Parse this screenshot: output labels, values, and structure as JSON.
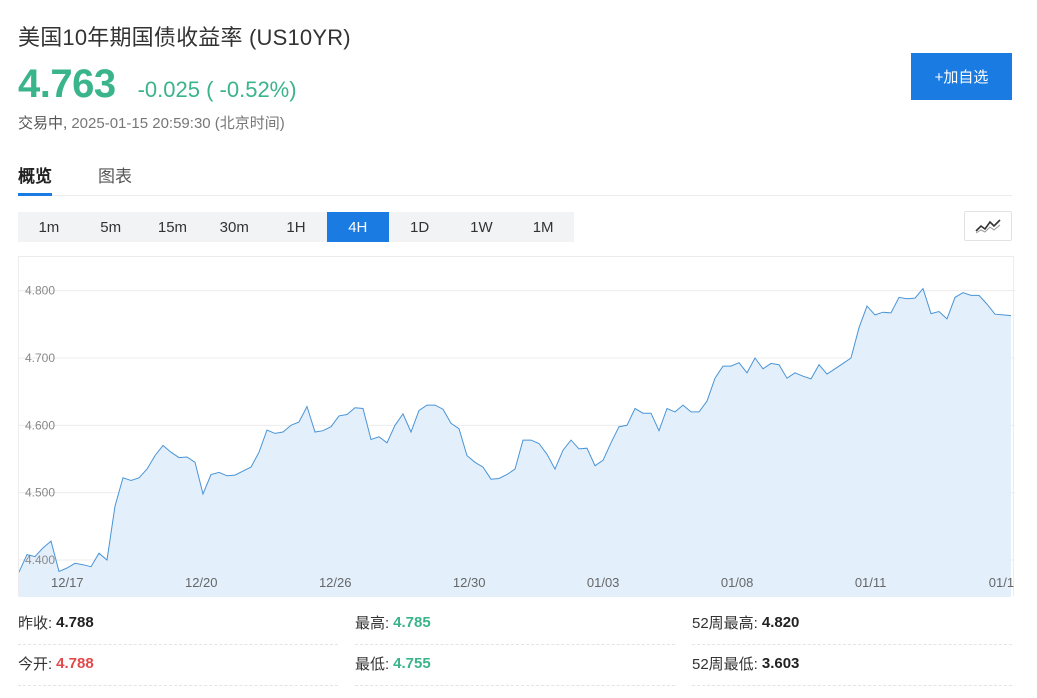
{
  "header": {
    "title": "美国10年期国债收益率 (US10YR)",
    "price": "4.763",
    "change": "-0.025 ( -0.52%)",
    "status_label": "交易中,",
    "timestamp": "2025-01-15 20:59:30 (北京时间)",
    "add_button": "+加自选"
  },
  "colors": {
    "accent": "#1a7be3",
    "down": "#3ab48a",
    "up": "#e24a4a",
    "line": "#4a94d6",
    "fill": "#e3f0fc"
  },
  "tabs": [
    {
      "label": "概览",
      "active": true
    },
    {
      "label": "图表",
      "active": false
    }
  ],
  "periods": [
    {
      "label": "1m",
      "active": false
    },
    {
      "label": "5m",
      "active": false
    },
    {
      "label": "15m",
      "active": false
    },
    {
      "label": "30m",
      "active": false
    },
    {
      "label": "1H",
      "active": false
    },
    {
      "label": "4H",
      "active": true
    },
    {
      "label": "1D",
      "active": false
    },
    {
      "label": "1W",
      "active": false
    },
    {
      "label": "1M",
      "active": false
    }
  ],
  "chart_type_icon": "line-chart-icon",
  "chart_data": {
    "type": "area",
    "y_ticks": [
      "4.800",
      "4.700",
      "4.600",
      "4.500",
      "4.400"
    ],
    "x_ticks": [
      "12/17",
      "12/20",
      "12/26",
      "12/30",
      "01/03",
      "01/08",
      "01/11",
      "01/1"
    ],
    "ylim": [
      4.345,
      4.85
    ],
    "grid": true,
    "values": [
      4.382,
      4.408,
      4.405,
      4.418,
      4.428,
      4.383,
      4.388,
      4.395,
      4.393,
      4.39,
      4.41,
      4.4,
      4.48,
      4.522,
      4.518,
      4.522,
      4.535,
      4.555,
      4.57,
      4.56,
      4.552,
      4.553,
      4.545,
      4.498,
      4.527,
      4.53,
      4.525,
      4.526,
      4.532,
      4.538,
      4.56,
      4.593,
      4.588,
      4.59,
      4.6,
      4.605,
      4.628,
      4.59,
      4.592,
      4.598,
      4.614,
      4.616,
      4.626,
      4.625,
      4.579,
      4.583,
      4.574,
      4.6,
      4.617,
      4.59,
      4.622,
      4.63,
      4.63,
      4.624,
      4.603,
      4.595,
      4.555,
      4.545,
      4.538,
      4.52,
      4.521,
      4.527,
      4.535,
      4.578,
      4.578,
      4.573,
      4.557,
      4.535,
      4.563,
      4.578,
      4.565,
      4.566,
      4.54,
      4.548,
      4.574,
      4.598,
      4.6,
      4.625,
      4.618,
      4.618,
      4.592,
      4.625,
      4.62,
      4.63,
      4.62,
      4.62,
      4.636,
      4.67,
      4.688,
      4.688,
      4.693,
      4.678,
      4.7,
      4.684,
      4.692,
      4.69,
      4.67,
      4.678,
      4.673,
      4.669,
      4.69,
      4.676,
      4.684,
      4.692,
      4.7,
      4.745,
      4.777,
      4.764,
      4.768,
      4.767,
      4.79,
      4.788,
      4.789,
      4.803,
      4.766,
      4.769,
      4.758,
      4.79,
      4.797,
      4.793,
      4.793,
      4.78,
      4.765,
      4.764,
      4.763
    ]
  },
  "stats": {
    "prev_close_label": "昨收:",
    "prev_close": "4.788",
    "open_label": "今开:",
    "open": "4.788",
    "high_label": "最高:",
    "high": "4.785",
    "low_label": "最低:",
    "low": "4.755",
    "high52_label": "52周最高:",
    "high52": "4.820",
    "low52_label": "52周最低:",
    "low52": "3.603"
  }
}
